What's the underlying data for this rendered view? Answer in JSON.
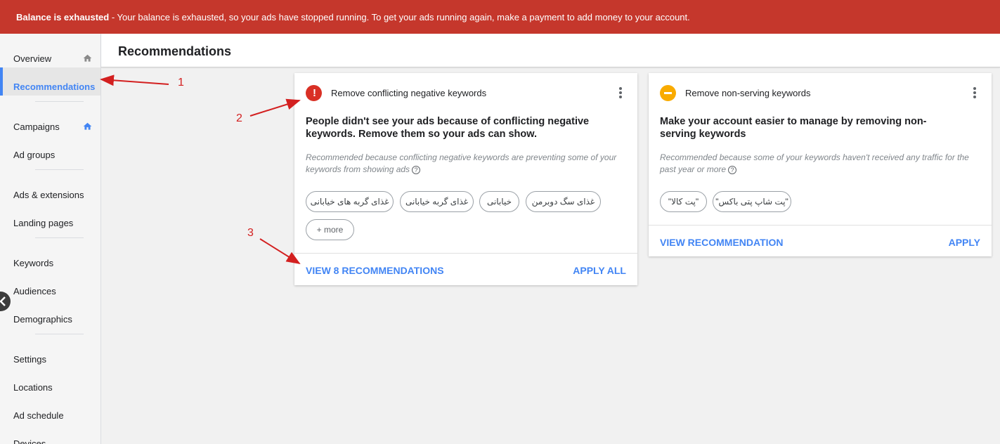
{
  "banner": {
    "bold_text": "Balance is exhausted",
    "text": " - Your balance is exhausted, so your ads have stopped running. To get your ads running again, make a payment to add money to your account."
  },
  "sidebar": {
    "items": [
      {
        "label": "Overview",
        "icon": "home-icon"
      },
      {
        "label": "Recommendations",
        "active": true
      },
      {
        "label": "Campaigns",
        "icon": "home-icon"
      },
      {
        "label": "Ad groups"
      },
      {
        "label": "Ads & extensions"
      },
      {
        "label": "Landing pages"
      },
      {
        "label": "Keywords"
      },
      {
        "label": "Audiences"
      },
      {
        "label": "Demographics"
      },
      {
        "label": "Settings"
      },
      {
        "label": "Locations"
      },
      {
        "label": "Ad schedule"
      },
      {
        "label": "Devices"
      }
    ]
  },
  "header": {
    "title": "Recommendations"
  },
  "cards": [
    {
      "status_icon": "error-icon",
      "title": "Remove conflicting negative keywords",
      "headline": "People didn't see your ads because of conflicting negative keywords. Remove them so your ads can show.",
      "reason": "Recommended because conflicting negative keywords are preventing some of your keywords from showing ads",
      "chips": [
        "غذای گربه های خیابانی",
        "غذای گربه خیابانی",
        "خیابانی",
        "غذای سگ دوبرمن",
        "+ more"
      ],
      "primary_action": "VIEW 8 RECOMMENDATIONS",
      "secondary_action": "APPLY ALL"
    },
    {
      "status_icon": "warning-icon",
      "title": "Remove non-serving keywords",
      "headline": "Make your account easier to manage by removing non-serving keywords",
      "reason": "Recommended because some of your keywords haven't received any traffic for the past year or more",
      "chips": [
        "\"پت کالا\"",
        "\"پت شاپ پتی باکس\""
      ],
      "primary_action": "VIEW RECOMMENDATION",
      "secondary_action": "APPLY"
    }
  ],
  "annotations": [
    "1",
    "2",
    "3"
  ],
  "colors": {
    "banner": "#c5372c",
    "accent": "#4285f4",
    "error": "#d93025",
    "warning": "#f9ab00",
    "annotation": "#d32020"
  }
}
